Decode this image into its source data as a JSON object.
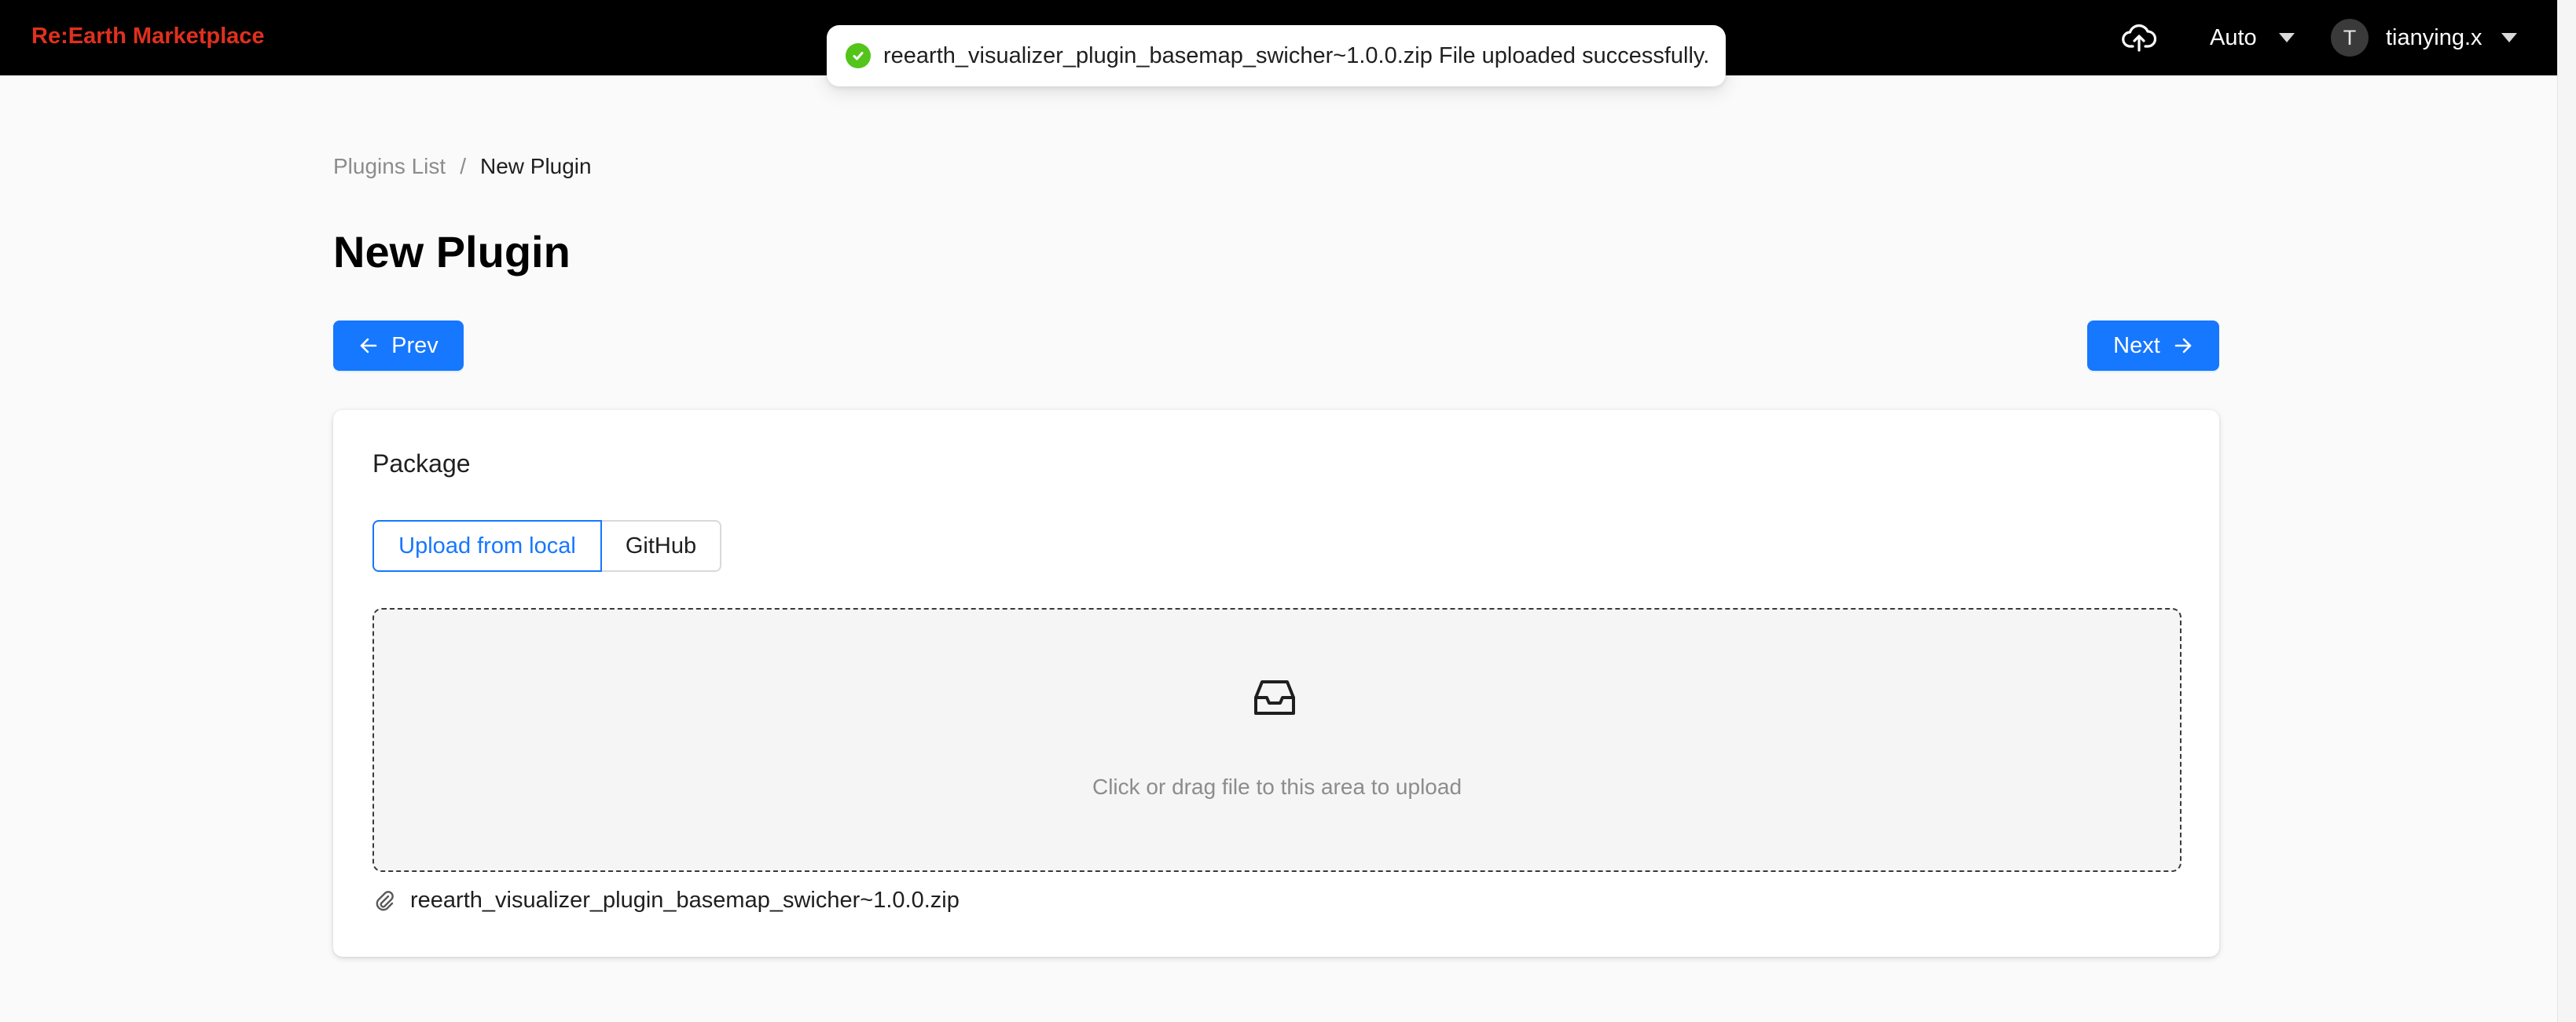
{
  "header": {
    "brand": "Re:Earth Marketplace",
    "upload_icon": "cloud-upload-icon",
    "theme_select": "Auto",
    "user": {
      "avatar_initial": "T",
      "name": "tianying.x"
    }
  },
  "toast": {
    "message": "reearth_visualizer_plugin_basemap_swicher~1.0.0.zip File uploaded successfully.",
    "status_color": "#52c41a"
  },
  "breadcrumb": {
    "parent": "Plugins List",
    "separator": "/",
    "current": "New Plugin"
  },
  "page": {
    "title": "New Plugin"
  },
  "nav": {
    "prev_label": "Prev",
    "next_label": "Next"
  },
  "package_card": {
    "title": "Package",
    "tabs": [
      {
        "label": "Upload from local",
        "selected": true
      },
      {
        "label": "GitHub",
        "selected": false
      }
    ],
    "dropzone_hint": "Click or drag file to this area to upload",
    "uploaded_file": "reearth_visualizer_plugin_basemap_swicher~1.0.0.zip"
  },
  "colors": {
    "accent": "#1677ff",
    "brand": "#e0301e",
    "success": "#52c41a"
  }
}
